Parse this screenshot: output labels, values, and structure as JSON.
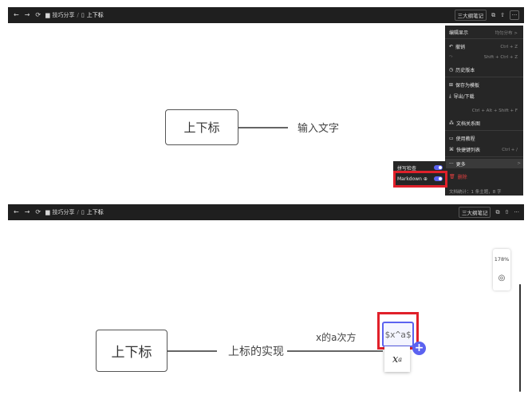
{
  "toolbar": {
    "back": "←",
    "forward": "→",
    "refresh": "⟳",
    "folder_label": "技巧分享",
    "separator": "/",
    "doc_label": "上下标",
    "outline_label": "三大纲笔记",
    "more": "···"
  },
  "panel1": {
    "root_node": "上下标",
    "child_node": "输入文字"
  },
  "menu": {
    "title": "编辑显示",
    "title_value": "均匀分布 >",
    "undo": "撤销",
    "undo_shortcut": "Ctrl + Z",
    "redo_shortcut": "Shift + Ctrl + Z",
    "history": "历史版本",
    "save_template": "保存为模板",
    "export": "导出/下载",
    "find_shortcut": "Ctrl + Alt + Shift + F",
    "relation_map": "文档关系图",
    "tutorial": "使用教程",
    "shortcuts": "快捷键列表",
    "shortcuts_shortcut": "Ctrl + /",
    "more": "更多",
    "more_arrow": ">",
    "delete": "删除",
    "footer": "文档统计：1 条主题，8 字"
  },
  "submenu": {
    "spellcheck": "拼写检查",
    "markdown": "Markdown ⊕"
  },
  "panel2": {
    "root_node": "上下标",
    "child_node": "上标的实现",
    "grandchild_node": "x的a次方",
    "formula_input": "$x^a$",
    "preview_base": "x",
    "preview_sup": "a",
    "zoom": "178%",
    "plus": "+"
  }
}
